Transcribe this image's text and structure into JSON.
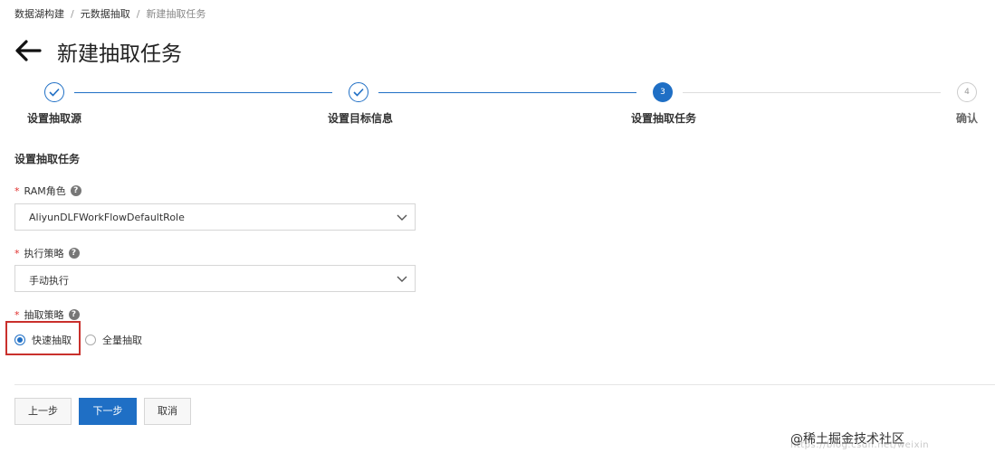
{
  "breadcrumb": {
    "items": [
      "数据湖构建",
      "元数据抽取"
    ],
    "current": "新建抽取任务",
    "separator": "/"
  },
  "header": {
    "title": "新建抽取任务",
    "back_icon": "arrow-left-icon"
  },
  "steps": [
    {
      "label": "设置抽取源",
      "status": "done"
    },
    {
      "label": "设置目标信息",
      "status": "done"
    },
    {
      "label": "设置抽取任务",
      "status": "current",
      "number": "3"
    },
    {
      "label": "确认",
      "status": "todo",
      "number": "4"
    }
  ],
  "form": {
    "section_title": "设置抽取任务",
    "required_mark": "*",
    "help_glyph": "?",
    "ram_role": {
      "label": "RAM角色",
      "value": "AliyunDLFWorkFlowDefaultRole"
    },
    "exec_policy": {
      "label": "执行策略",
      "value": "手动执行"
    },
    "extract_policy": {
      "label": "抽取策略",
      "options": [
        {
          "label": "快速抽取",
          "selected": true
        },
        {
          "label": "全量抽取",
          "selected": false
        }
      ]
    }
  },
  "footer": {
    "prev_label": "上一步",
    "next_label": "下一步",
    "cancel_label": "取消"
  },
  "watermark": {
    "main": "@稀土掘金技术社区",
    "sub": "https://blog.csdn.net/weixin"
  },
  "colors": {
    "primary": "#1f6fc5",
    "required": "#e0302d",
    "highlight": "#c9302c"
  }
}
